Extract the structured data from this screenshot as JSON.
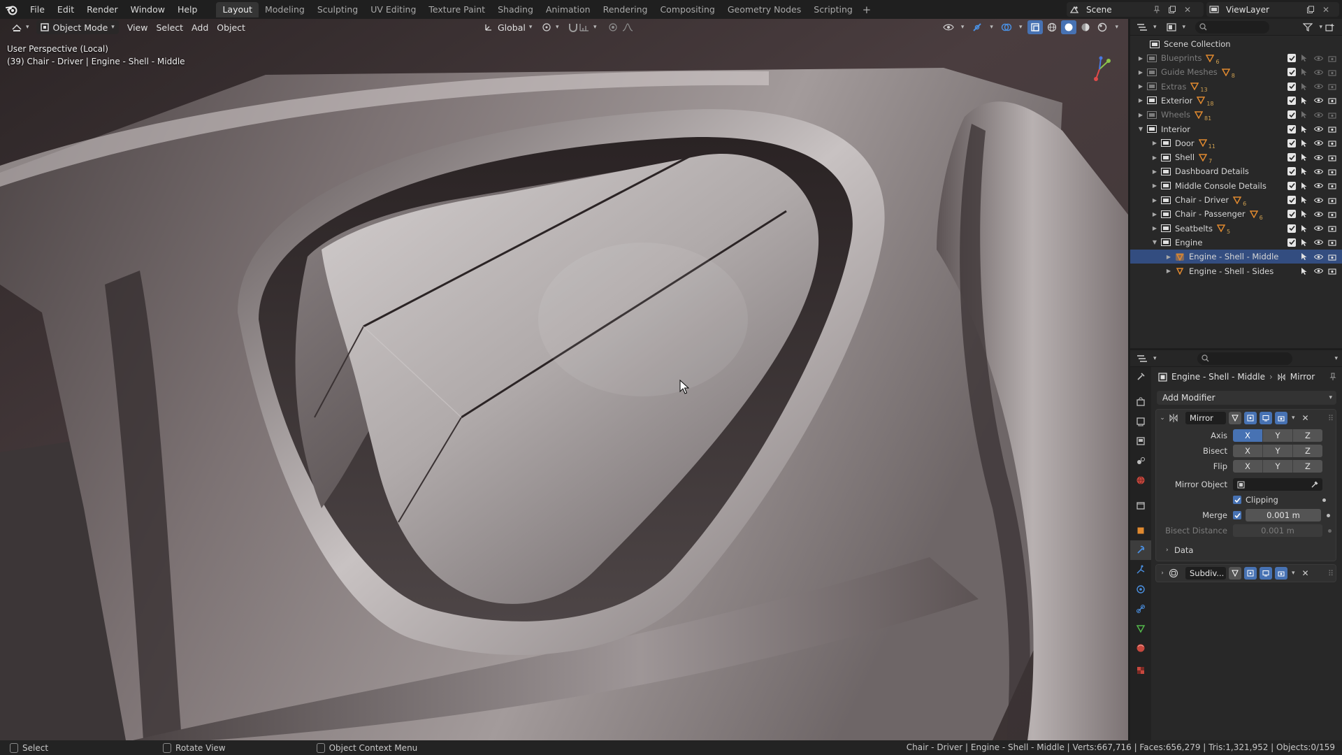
{
  "menubar": {
    "items": [
      "File",
      "Edit",
      "Render",
      "Window",
      "Help"
    ],
    "workspaces": [
      "Layout",
      "Modeling",
      "Sculpting",
      "UV Editing",
      "Texture Paint",
      "Shading",
      "Animation",
      "Rendering",
      "Compositing",
      "Geometry Nodes",
      "Scripting"
    ],
    "active_workspace": "Layout",
    "scene": "Scene",
    "view_layer": "ViewLayer"
  },
  "viewport": {
    "mode": "Object Mode",
    "menus": [
      "View",
      "Select",
      "Add",
      "Object"
    ],
    "transform_orientation": "Global",
    "info_line1": "User Perspective (Local)",
    "info_line2": "(39) Chair - Driver | Engine - Shell - Middle"
  },
  "outliner": {
    "root": "Scene Collection",
    "rows": [
      {
        "label": "Blueprints",
        "indent": 1,
        "expanded": false,
        "disabled": true,
        "badge": "6"
      },
      {
        "label": "Guide Meshes",
        "indent": 1,
        "expanded": false,
        "disabled": true,
        "badge": "8"
      },
      {
        "label": "Extras",
        "indent": 1,
        "expanded": false,
        "disabled": true,
        "badge": "13"
      },
      {
        "label": "Exterior",
        "indent": 1,
        "expanded": false,
        "disabled": false,
        "badge": "18"
      },
      {
        "label": "Wheels",
        "indent": 1,
        "expanded": false,
        "disabled": true,
        "badge": "81"
      },
      {
        "label": "Interior",
        "indent": 1,
        "expanded": true,
        "disabled": false,
        "badge": ""
      },
      {
        "label": "Door",
        "indent": 2,
        "expanded": false,
        "disabled": false,
        "badge": "11"
      },
      {
        "label": "Shell",
        "indent": 2,
        "expanded": false,
        "disabled": false,
        "badge": "7"
      },
      {
        "label": "Dashboard Details",
        "indent": 2,
        "expanded": false,
        "disabled": false,
        "badge": ""
      },
      {
        "label": "Middle Console Details",
        "indent": 2,
        "expanded": false,
        "disabled": false,
        "badge": ""
      },
      {
        "label": "Chair - Driver",
        "indent": 2,
        "expanded": false,
        "disabled": false,
        "badge": "6"
      },
      {
        "label": "Chair - Passenger",
        "indent": 2,
        "expanded": false,
        "disabled": false,
        "badge": "6"
      },
      {
        "label": "Seatbelts",
        "indent": 2,
        "expanded": false,
        "disabled": false,
        "badge": "5"
      },
      {
        "label": "Engine",
        "indent": 2,
        "expanded": true,
        "disabled": false,
        "badge": ""
      },
      {
        "label": "Engine - Shell - Middle",
        "indent": 3,
        "expanded": false,
        "disabled": false,
        "badge": "",
        "object": true,
        "selected": true
      },
      {
        "label": "Engine - Shell - Sides",
        "indent": 3,
        "expanded": false,
        "disabled": false,
        "badge": "",
        "object": true
      }
    ]
  },
  "properties": {
    "object_name": "Engine - Shell - Middle",
    "modifier_crumb": "Mirror",
    "add_modifier": "Add Modifier",
    "mirror": {
      "name": "Mirror",
      "axis_label": "Axis",
      "bisect_label": "Bisect",
      "flip_label": "Flip",
      "axis_letters": [
        "X",
        "Y",
        "Z"
      ],
      "axis_active": "X",
      "mirror_object_label": "Mirror Object",
      "clipping_label": "Clipping",
      "merge_label": "Merge",
      "merge_value": "0.001 m",
      "bisect_distance_label": "Bisect Distance",
      "bisect_distance_value": "0.001 m",
      "data_label": "Data"
    },
    "subdiv": {
      "name": "Subdiv..."
    }
  },
  "statusbar": {
    "select": "Select",
    "rotate": "Rotate View",
    "context": "Object Context Menu",
    "stats": "Chair - Driver | Engine - Shell - Middle | Verts:667,716 | Faces:656,279 | Tris:1,321,952 | Objects:0/159"
  },
  "colors": {
    "accent": "#4772b3",
    "selection": "#334d80",
    "panel_bg": "#282828",
    "header_bg": "#1f1f1f"
  }
}
